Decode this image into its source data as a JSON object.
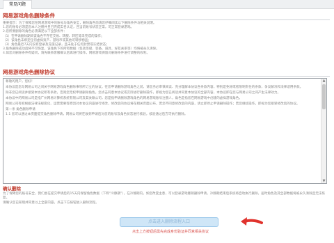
{
  "tabs": {
    "active": "常见问题"
  },
  "conditions": {
    "title": "网易游戏角色删除条件",
    "lines": [
      "重要提示：为了保障您在网易游戏中的账号与角色安全，删除角色前请您仔细阅读以下删除条件与相关说明。",
      "1.您的账号必须是您本人注册并且已完成实名认证，且当前账号状态正常，可正常登录游戏。",
      "2.您所要删除的角色必须满足以下全部条件：",
      "（1）在申请删除期间该角色不存在交易、转服、转区等未完成的操作；",
      "（2）该角色未绑定任何虚拟资产、游戏币或其他可转移物品；",
      "（3）角色最近7天内没有登录及充值记录，且未处于任何封禁或冻结状态；",
      "3.角色删除成功后将不可恢复，该角色下的所有数据（包括等级、装备、道具、好友关系等）均将被永久清除。",
      "4.如您对删除条件有疑问，请先联系客服确认后再进行操作，网易游戏保留对删除条件进行调整的权利。"
    ]
  },
  "agreement": {
    "title": "网易游戏角色删除协议",
    "paragraphs": [
      "尊敬的用户，您好！",
      "本协议是您与网易公司之间关于网易游戏角色删除事项所订立的协议。在您申请删除游戏角色之前，请您务必审慎阅读、充分理解本协议各条款内容，特别是免除或者限制责任的条款、争议解决和法律适用条款。",
      "除非您已阅读并接受本协议所有条款，否则您无权申请删除角色。您点击同意本协议或实际进行删除操作，即视为您已阅读并同意本协议的全部内容，本协议即在您与网易公司之间产生法律效力。",
      "本协议中的网易公司是指广州网易计算机系统有限公司及其关联公司，您是指申请删除游戏角色的网易游戏账号注册人，角色是指您在网易游戏中创建的虚拟游戏角色。",
      "网易公司有权根据法律法规变化、运营需要等原因对本协议内容进行修改，修改后的协议将在相关页面公布，若您不同意修改后的内容，请立即停止申请删除操作；若您继续操作，即视为您接受修改后的协议。",
      "第一条 角色删除申请",
      "1.1 您可以通过本页面提交角色删除申请，网易公司将在收到申请后对您的账号及角色状态进行核验，核验通过后方可执行删除。"
    ]
  },
  "confirm": {
    "title": "确认删除",
    "lines": [
      "为了保障您的账号安全，我们会在提交申请后的15天内保留角色数据（下称“冷静期”），在冷静期内，如您改变主意，可以登录游戏撤销删除申请。冷静期结束后系统将自动执行删除，届时角色及其全部数据将被永久清除且无法恢复。",
      "请确认您已知晓并同意以上全部内容，点击下方按钮进入删除流程。"
    ]
  },
  "enter_button": {
    "label": "点击进入删除流程入口"
  },
  "note": {
    "text": "点击上方按钮后需先完成身份验证并同意相关协议"
  },
  "colors": {
    "accent_red": "#c0392b",
    "button_blue": "#cfe6f7",
    "arrow_red": "#e0332d"
  }
}
